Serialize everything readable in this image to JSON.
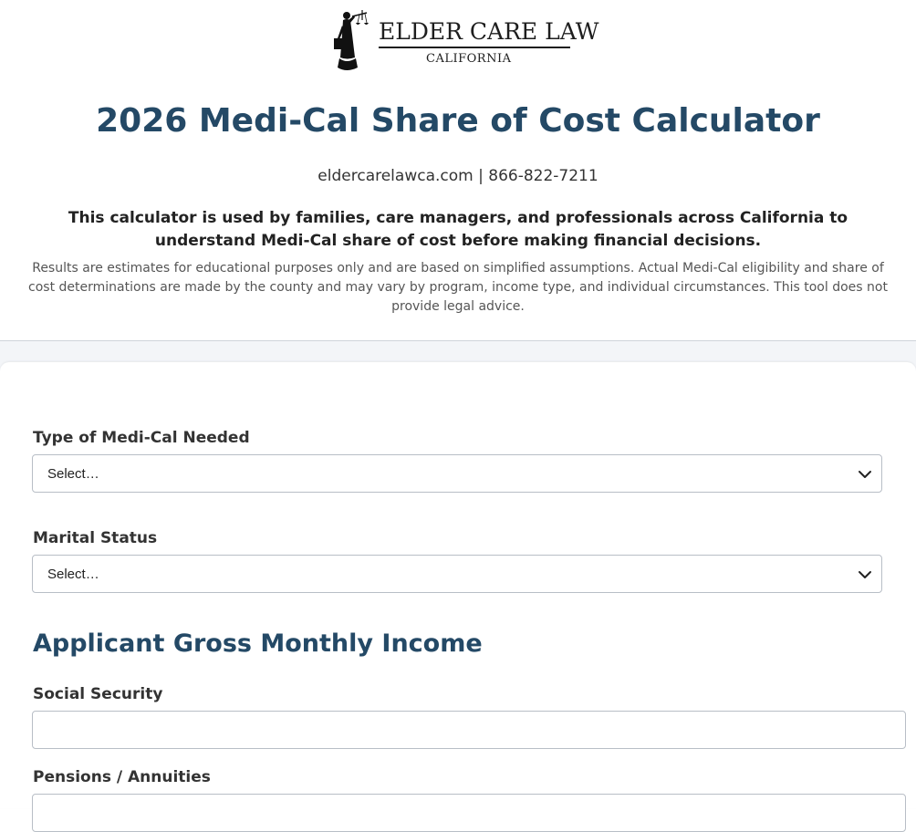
{
  "logo": {
    "title": "ELDER CARE LAW",
    "subtitle": "CALIFORNIA",
    "figure_icon": "lady-justice-icon"
  },
  "page": {
    "title": "2026 Medi-Cal Share of Cost Calculator",
    "website": "eldercarelawca.com",
    "separator": " | ",
    "phone": "866-822-7211",
    "intro": "This calculator is used by families, care managers, and professionals across California to understand Medi-Cal share of cost before making financial decisions.",
    "disclaimer": "Results are estimates for educational purposes only and are based on simplified assumptions. Actual Medi-Cal eligibility and share of cost determinations are made by the county and may vary by program, income type, and individual circumstances. This tool does not provide legal advice."
  },
  "form": {
    "medi_cal_type": {
      "label": "Type of Medi-Cal Needed",
      "selected": "Select…"
    },
    "marital_status": {
      "label": "Marital Status",
      "selected": "Select…"
    },
    "income_section": {
      "heading": "Applicant Gross Monthly Income",
      "social_security": {
        "label": "Social Security",
        "value": ""
      },
      "pensions": {
        "label": "Pensions / Annuities",
        "value": ""
      }
    }
  },
  "colors": {
    "heading": "#244966",
    "background_band": "#f3f5f8",
    "border": "#b8bec6"
  },
  "icons": {
    "select_chevron": "chevron-down-icon"
  }
}
